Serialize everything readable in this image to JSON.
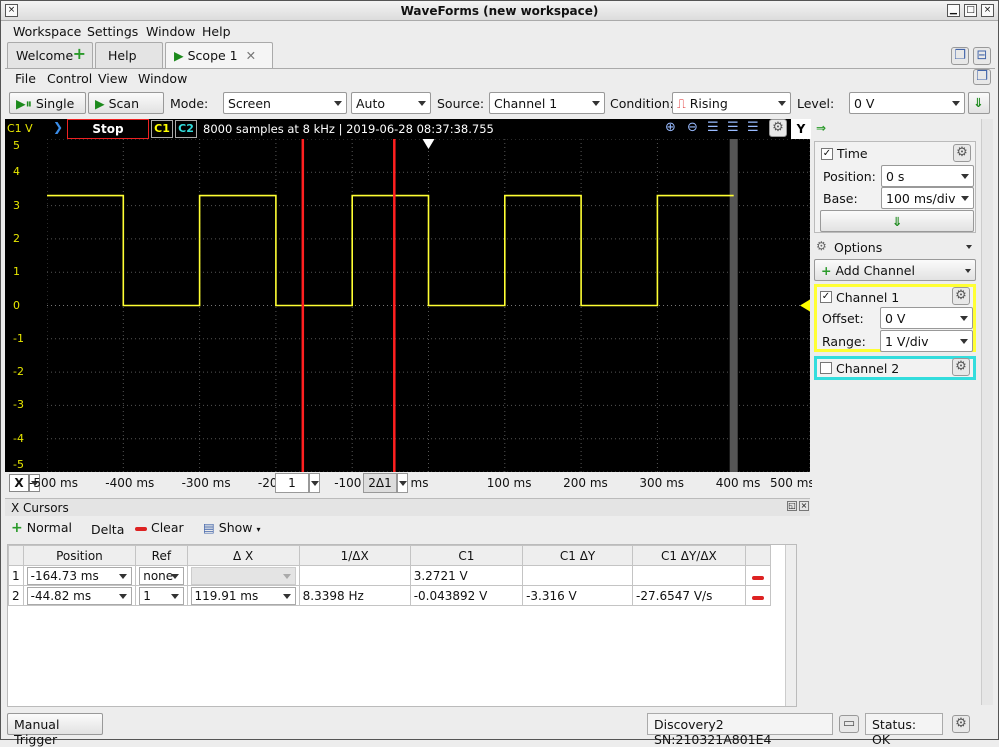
{
  "window": {
    "title": "WaveForms (new workspace)"
  },
  "menu1": [
    "Workspace",
    "Settings",
    "Window",
    "Help"
  ],
  "tabs": [
    {
      "label": "Welcome",
      "active": false
    },
    {
      "label": "Help",
      "active": false
    },
    {
      "label": "Scope 1",
      "active": true
    }
  ],
  "menu2": [
    "File",
    "Control",
    "View",
    "Window"
  ],
  "toolbar": {
    "single_label": "Single",
    "scan_label": "Scan",
    "mode_label": "Mode:",
    "mode_value": "Screen",
    "auto_value": "Auto",
    "source_label": "Source:",
    "source_value": "Channel 1",
    "condition_label": "Condition:",
    "condition_value": "Rising",
    "level_label": "Level:",
    "level_value": "0 V"
  },
  "scopebar": {
    "unit": "C1 V",
    "status": "Stop",
    "c1": "C1",
    "c2": "C2",
    "info": "8000 samples at 8 kHz | 2019-06-28 08:37:38.755",
    "y_button": "Y"
  },
  "colors": {
    "trace": "#ffff33",
    "cursor": "#ff2020",
    "c1": "#ffff00",
    "c2": "#33dddd"
  },
  "chart_data": {
    "type": "line",
    "x_unit": "ms",
    "y_unit": "V",
    "xlim": [
      -500,
      500
    ],
    "ylim": [
      -5,
      5
    ],
    "y_ticks": [
      "5",
      "4",
      "3",
      "2",
      "1",
      "0",
      "-1",
      "-2",
      "-3",
      "-4",
      "-5"
    ],
    "x_ticks": [
      "-500 ms",
      "-400 ms",
      "-300 ms",
      "-20",
      "-100 m",
      "ms",
      "100 ms",
      "200 ms",
      "300 ms",
      "400 ms",
      "500 ms"
    ],
    "series": [
      {
        "x": [
          -500,
          -400,
          -400,
          -300,
          -300,
          -200,
          -200,
          -100,
          -100,
          0,
          0,
          100,
          100,
          200,
          200,
          300,
          300,
          400
        ],
        "y": [
          3.3,
          3.3,
          0,
          0,
          3.3,
          3.3,
          0,
          0,
          3.3,
          3.3,
          0,
          0,
          3.3,
          3.3,
          0,
          0,
          3.3,
          3.3
        ]
      }
    ],
    "cursors": [
      -164.73,
      -44.82
    ],
    "cursor_labels": [
      "1",
      "2Δ1"
    ]
  },
  "xaxis_bar": {
    "x_button": "X"
  },
  "right_panel": {
    "arrow": "⇒",
    "time_label": "Time",
    "position_label": "Position:",
    "position_value": "0 s",
    "base_label": "Base:",
    "base_value": "100 ms/div",
    "options_label": "Options",
    "add_channel_label": "Add Channel",
    "ch1_label": "Channel 1",
    "offset_label": "Offset:",
    "offset_value": "0 V",
    "range_label": "Range:",
    "range_value": "1 V/div",
    "ch2_label": "Channel 2"
  },
  "cursors_panel": {
    "title": "X Cursors",
    "normal_label": "Normal",
    "delta_label": "Delta",
    "clear_label": "Clear",
    "show_label": "Show",
    "headers": [
      "Position",
      "Ref",
      "Δ X",
      "1/ΔX",
      "C1",
      "C1 ΔY",
      "C1 ΔY/ΔX"
    ],
    "rows": [
      {
        "n": "1",
        "position": "-164.73 ms",
        "ref": "none",
        "dx": "",
        "inv": "",
        "c1": "3.2721 V",
        "dy": "",
        "dydx": ""
      },
      {
        "n": "2",
        "position": "-44.82 ms",
        "ref": "1",
        "dx": "119.91 ms",
        "inv": "8.3398 Hz",
        "c1": "-0.043892 V",
        "dy": "-3.316 V",
        "dydx": "-27.6547 V/s"
      }
    ]
  },
  "statusbar": {
    "manual_trigger": "Manual Trigger",
    "device": "Discovery2 SN:210321A801E4",
    "status": "Status: OK"
  }
}
